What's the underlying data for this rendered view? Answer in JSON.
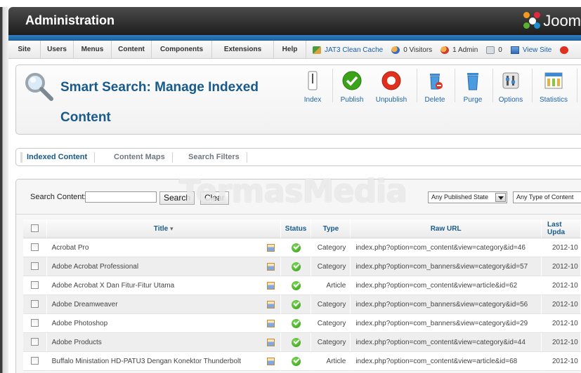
{
  "header": {
    "title": "Administration",
    "brand": "Joom"
  },
  "menu": [
    {
      "label": "Site",
      "w": 46
    },
    {
      "label": "Users",
      "w": 47
    },
    {
      "label": "Menus",
      "w": 54
    },
    {
      "label": "Content",
      "w": 57
    },
    {
      "label": "Components",
      "w": 86
    },
    {
      "label": "Extensions",
      "w": 88
    },
    {
      "label": "Help",
      "w": 46
    }
  ],
  "status": {
    "cache": "JAT3 Clean Cache",
    "visitors": "0 Visitors",
    "admins": "1 Admin",
    "messages": "0",
    "view_site": "View Site"
  },
  "page": {
    "title": "Smart Search: Manage Indexed Content"
  },
  "toolbar": {
    "index": "Index",
    "publish": "Publish",
    "unpublish": "Unpublish",
    "delete": "Delete",
    "purge": "Purge",
    "options": "Options",
    "statistics": "Statistics"
  },
  "tabs": {
    "indexed": "Indexed Content",
    "maps": "Content Maps",
    "filters": "Search Filters"
  },
  "filter": {
    "label": "Search Content:",
    "search": "Search",
    "clear": "Clear",
    "state": "Any Published State",
    "type": "Any Type of Content"
  },
  "watermark": "TermasMedia",
  "table": {
    "headers": {
      "title": "Title",
      "status": "Status",
      "type": "Type",
      "url": "Raw URL",
      "updated": "Last Upda"
    },
    "rows": [
      {
        "title": "Acrobat Pro",
        "type": "Category",
        "url": "index.php?option=com_content&view=category&id=46",
        "date": "2012-10"
      },
      {
        "title": "Adobe Acrobat Professional",
        "type": "Category",
        "url": "index.php?option=com_banners&view=category&id=57",
        "date": "2012-10"
      },
      {
        "title": "Adobe Acrobat X Dan Fitur-Fitur Utama",
        "type": "Article",
        "url": "index.php?option=com_content&view=article&id=62",
        "date": "2012-10"
      },
      {
        "title": "Adobe Dreamweaver",
        "type": "Category",
        "url": "index.php?option=com_banners&view=category&id=56",
        "date": "2012-10"
      },
      {
        "title": "Adobe Photoshop",
        "type": "Category",
        "url": "index.php?option=com_banners&view=category&id=29",
        "date": "2012-10"
      },
      {
        "title": "Adobe Products",
        "type": "Category",
        "url": "index.php?option=com_content&view=category&id=44",
        "date": "2012-10"
      },
      {
        "title": "Buffalo Ministation HD-PATU3 Dengan Konektor Thunderbolt",
        "type": "Article",
        "url": "index.php?option=com_content&view=article&id=68",
        "date": "2012-10"
      }
    ]
  }
}
